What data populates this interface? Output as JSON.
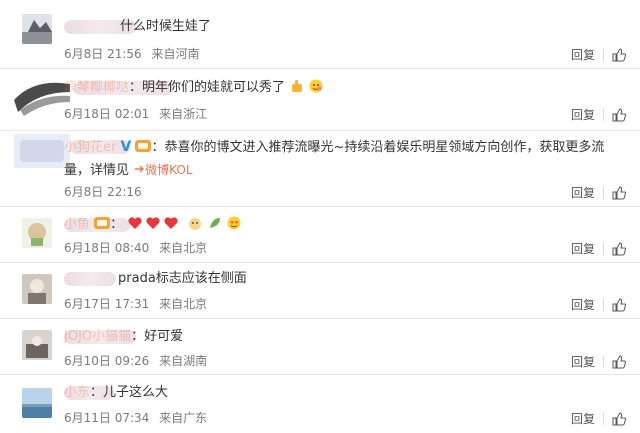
{
  "comments": [
    {
      "name": "",
      "text": "什么时候生娃了",
      "time": "6月8日 21:56",
      "location": "来自河南",
      "reply": "回复"
    },
    {
      "name": "浪琴椰椰哒",
      "text": "：明年你们的娃就可以秀了",
      "time": "6月18日 02:01",
      "location": "来自浙江",
      "reply": "回复"
    },
    {
      "name": "小狗花er",
      "text": "：恭喜你的博文进入推荐流曝光~持续沿着娱乐明星领域方向创作，获取更多流量，详情见",
      "kol": "微博KOL",
      "time": "6月8日 22:16",
      "location": "",
      "reply": "回复"
    },
    {
      "name": "小鱼",
      "text": "：",
      "time": "6月18日 08:40",
      "location": "来自北京",
      "reply": "回复"
    },
    {
      "name": "",
      "text": "prada标志应该在侧面",
      "time": "6月17日 17:31",
      "location": "来自北京",
      "reply": "回复"
    },
    {
      "name": "JOJO小猫猫",
      "text": "：好可爱",
      "time": "6月10日 09:26",
      "location": "来自湖南",
      "reply": "回复"
    },
    {
      "name": "小东",
      "text": "：儿子这么大",
      "time": "6月11日 07:34",
      "location": "来自广东",
      "reply": "回复"
    }
  ],
  "icons": {
    "thumb": "thumbs-up-icon",
    "verified": "verified-v-icon",
    "colors": {
      "accent": "#eb7350",
      "heart": "#e8373a",
      "verified": "#2f8fe0"
    }
  }
}
